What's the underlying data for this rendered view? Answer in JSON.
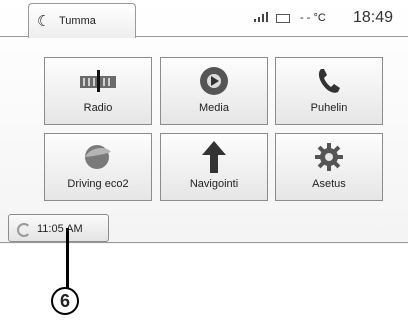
{
  "header": {
    "mode_label": "Tumma",
    "temperature": "- - °C",
    "clock": "18:49"
  },
  "tiles": [
    {
      "label": "Radio",
      "icon": "radio-icon"
    },
    {
      "label": "Media",
      "icon": "media-play-icon"
    },
    {
      "label": "Puhelin",
      "icon": "phone-icon"
    },
    {
      "label": "Driving eco2",
      "icon": "eco-leaf-icon"
    },
    {
      "label": "Navigointi",
      "icon": "navigation-arrow-icon"
    },
    {
      "label": "Asetus",
      "icon": "settings-gear-icon"
    }
  ],
  "time_button": {
    "label": "11:05 AM"
  },
  "callout": {
    "number": "6"
  }
}
